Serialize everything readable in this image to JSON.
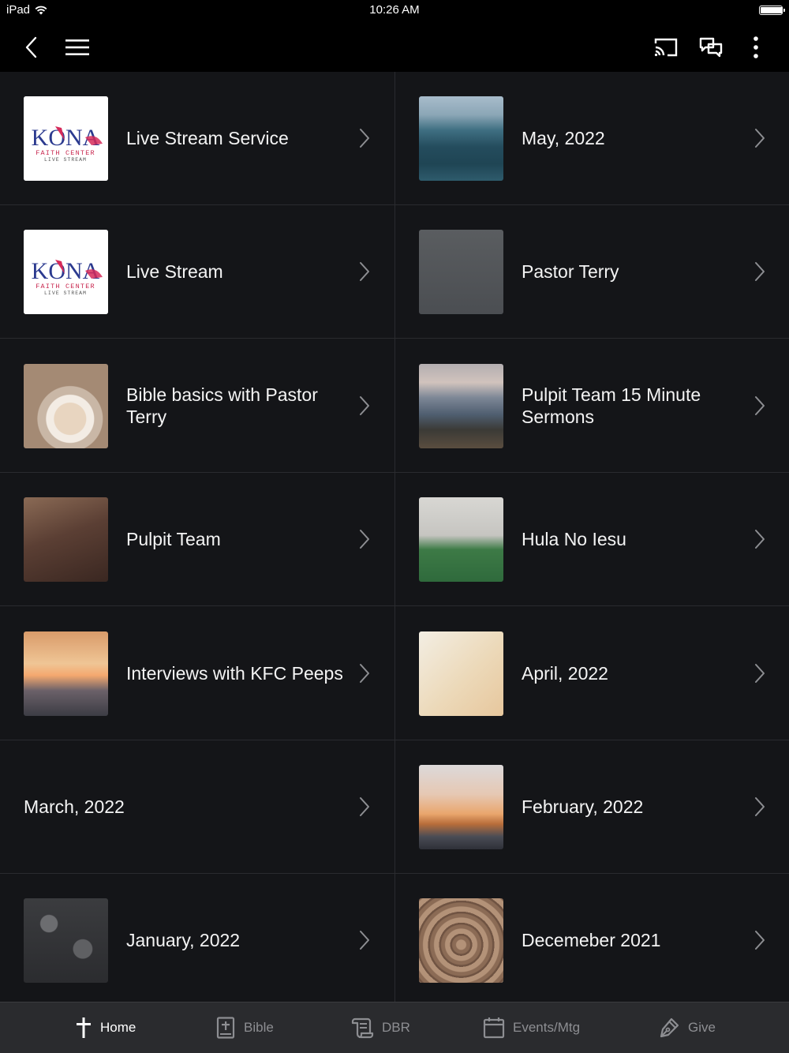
{
  "status_bar": {
    "device": "iPad",
    "time": "10:26 AM",
    "battery_level": 1.0
  },
  "nav": {
    "back_icon": "chevron-left-icon",
    "menu_icon": "hamburger-menu-icon",
    "cast_icon": "cast-icon",
    "chat_icon": "chat-icon",
    "more_icon": "more-vertical-icon"
  },
  "items": [
    {
      "title": "Live Stream Service",
      "thumb": "logo"
    },
    {
      "title": "May, 2022",
      "thumb": "sea"
    },
    {
      "title": "Live Stream",
      "thumb": "logo"
    },
    {
      "title": "Pastor Terry",
      "thumb": "portrait"
    },
    {
      "title": "Bible basics with Pastor Terry",
      "thumb": "coffee"
    },
    {
      "title": "Pulpit Team 15 Minute Sermons",
      "thumb": "mountain"
    },
    {
      "title": "Pulpit Team",
      "thumb": "desk"
    },
    {
      "title": "Hula No Iesu",
      "thumb": "group"
    },
    {
      "title": "Interviews with KFC Peeps",
      "thumb": "sunset"
    },
    {
      "title": "April, 2022",
      "thumb": "palm"
    },
    {
      "title": "March, 2022",
      "thumb": ""
    },
    {
      "title": "February, 2022",
      "thumb": "sunrise"
    },
    {
      "title": "January, 2022",
      "thumb": "snow"
    },
    {
      "title": "Decemeber 2021",
      "thumb": "wood"
    }
  ],
  "logo": {
    "line1": "KONA",
    "line2": "FAITH CENTER",
    "line3": "LIVE STREAM"
  },
  "tabs": [
    {
      "label": "Home",
      "icon": "cross-icon",
      "active": true
    },
    {
      "label": "Bible",
      "icon": "bible-icon",
      "active": false
    },
    {
      "label": "DBR",
      "icon": "scroll-icon",
      "active": false
    },
    {
      "label": "Events/Mtg",
      "icon": "calendar-icon",
      "active": false
    },
    {
      "label": "Give",
      "icon": "pen-icon",
      "active": false
    }
  ],
  "colors": {
    "background": "#141518",
    "bar": "#000000",
    "tabbar": "#2a2b2e",
    "inactive": "#8d8e92"
  }
}
